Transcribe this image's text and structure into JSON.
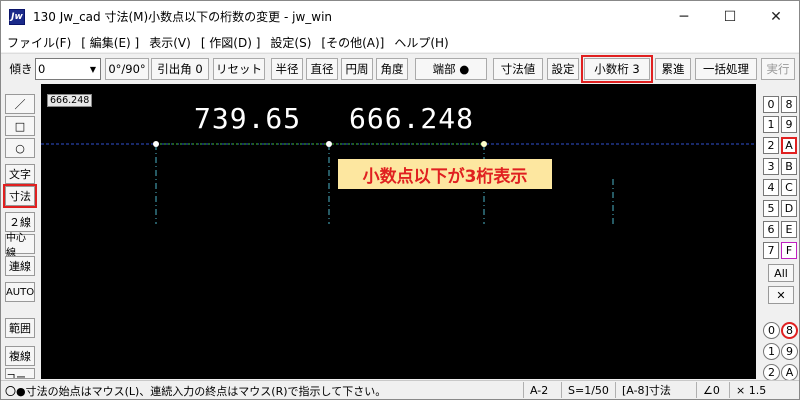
{
  "window": {
    "icon_text": "Jw",
    "title": "130 Jw_cad 寸法(M)小数点以下の桁数の変更 - jw_win",
    "minimize": "─",
    "maximize": "☐",
    "close": "✕"
  },
  "menu": [
    "ファイル(F)",
    "[ 編集(E) ]",
    "表示(V)",
    "[ 作図(D) ]",
    "設定(S)",
    "[その他(A)]",
    "ヘルプ(H)"
  ],
  "toolbar": {
    "tilt_label": "傾き",
    "tilt_value": "0",
    "angle_btn": "0°/90°",
    "hikidashi_btn": "引出角 0",
    "reset_btn": "リセット",
    "radius_btn": "半径",
    "diameter_btn": "直径",
    "circumference_btn": "円周",
    "angle_mode_btn": "角度",
    "endpoint_btn": "端部 ●",
    "dimension_value_btn": "寸法値",
    "settings_btn": "設定",
    "decimal_btn": "小数桁 3",
    "cumulative_btn": "累進",
    "batch_btn": "一括処理",
    "execute_btn": "実行"
  },
  "left_tools": {
    "line": "／",
    "rect": "□",
    "circle": "○",
    "text": "文字",
    "dimension": "寸法",
    "double_line": "２線",
    "center_line": "中心線",
    "continuous_line": "連線",
    "auto": "AUTO",
    "range": "範囲",
    "copy_line": "複線",
    "corner": "コーナー"
  },
  "canvas": {
    "scale_tag": "666.248",
    "dim1": "739.65",
    "dim2": "666.248",
    "note": "小数点以下が3桁表示"
  },
  "right_panel": {
    "left_col": [
      "0",
      "1",
      "2",
      "3",
      "4",
      "5",
      "6",
      "7"
    ],
    "right_col": [
      "8",
      "9",
      "A",
      "B",
      "C",
      "D",
      "E",
      "F"
    ],
    "all": "All",
    "cross": "✕",
    "layer_left": [
      "0",
      "1",
      "2"
    ],
    "layer_right": [
      "8",
      "9",
      "A"
    ]
  },
  "status": {
    "message": "〇●寸法の始点はマウス(L)、連続入力の終点はマウス(R)で指示して下さい。",
    "paper": "A-2",
    "scale": "S=1/50",
    "layer": "[A-8]寸法",
    "angle": "∠0",
    "factor": "× 1.5"
  },
  "colors": {
    "highlight": "#e02020",
    "canvas_bg": "#000000",
    "dim_line": "#4db3c7",
    "baseline": "#3050d0",
    "note_bg": "#fde7a0"
  }
}
